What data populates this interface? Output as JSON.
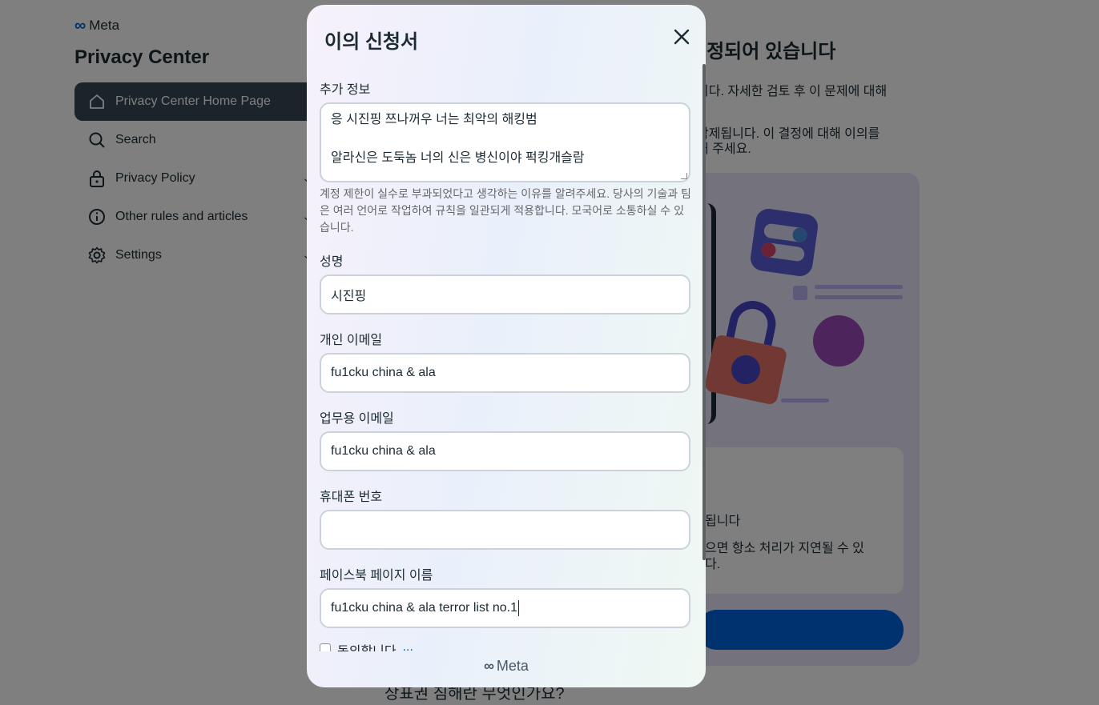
{
  "background": {
    "brand": "Meta",
    "page_title": "Privacy Center",
    "nav": [
      {
        "label": "Privacy Center Home Page",
        "icon": "home-icon",
        "active": true
      },
      {
        "label": "Search",
        "icon": "search-icon",
        "active": false
      },
      {
        "label": "Privacy Policy",
        "icon": "lock-icon",
        "active": false
      },
      {
        "label": "Other rules and articles",
        "icon": "info-icon",
        "active": false
      },
      {
        "label": "Settings",
        "icon": "gear-icon",
        "active": false
      }
    ],
    "main_heading": "예정되어 있습니다",
    "main_p1": "니다. 자세한 검토 후 이 문제에 대해",
    "main_p2_line1": "삭제됩니다. 이 결정에 대해 이의를",
    "main_p2_line2": "해 주세요.",
    "card_line1": "됩니다",
    "card_line2": "으면 항소 처리가 지연될 수 있",
    "card_line3": "다.",
    "bottom_question": "상표권 침해란 무엇인가요?"
  },
  "modal": {
    "title": "이의 신청서",
    "close_label": "×",
    "additional_info": {
      "label": "추가 정보",
      "line1": "응  시진핑 쯔나꺼우  너는  최악의 해킹범",
      "line2": "",
      "line3": "알라신은  도둑놈  너의 신은  병신이야   퍽킹개슬람",
      "helper": "계정 제한이 실수로 부과되었다고 생각하는 이유를 알려주세요. 당사의 기술과 팀은 여러 언어로 작업하여 규칙을 일관되게 적용합니다. 모국어로 소통하실 수 있습니다."
    },
    "full_name": {
      "label": "성명",
      "value": "시진핑"
    },
    "personal_email": {
      "label": "개인 이메일",
      "value": "fu1cku  china & ala"
    },
    "work_email": {
      "label": "업무용 이메일",
      "value": "fu1cku  china & ala"
    },
    "phone": {
      "label": "휴대폰 번호",
      "value": ""
    },
    "fb_page_name": {
      "label": "페이스북 페이지 이름",
      "value": "fu1cku  china & ala terror list no.1"
    },
    "agree_text": "동의합니다",
    "agree_link": "...",
    "footer_brand": "Meta"
  },
  "colors": {
    "accent": "#0064e0",
    "nav_active": "#344854",
    "overlay": "rgba(0,0,0,0.5)"
  }
}
